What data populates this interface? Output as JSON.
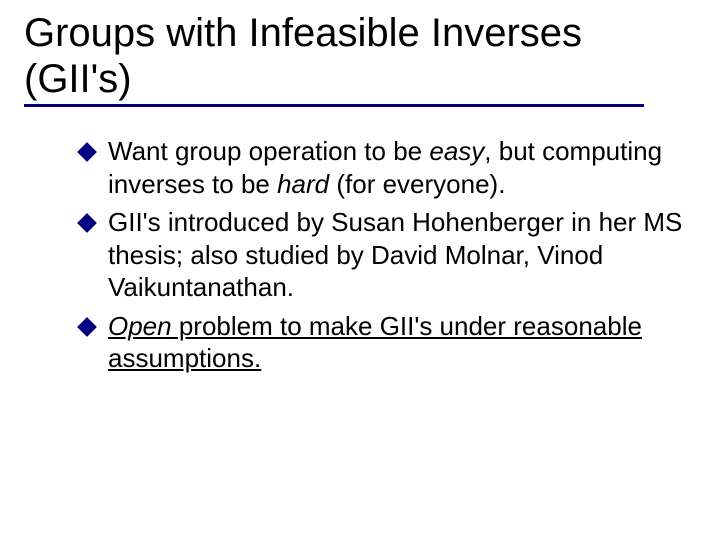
{
  "title": "Groups with Infeasible Inverses (GII's)",
  "bullets": [
    {
      "pre": "Want group operation to be ",
      "em1": "easy",
      "mid": ", but computing inverses to be ",
      "em2": "hard",
      "post": "  (for everyone)."
    },
    {
      "text": "GII's introduced by Susan Hohenberger in her MS thesis; also studied by David Molnar, Vinod Vaikuntanathan."
    },
    {
      "open_em": "Open",
      "open_rest": " problem to make GII's under reasonable assumptions."
    }
  ]
}
